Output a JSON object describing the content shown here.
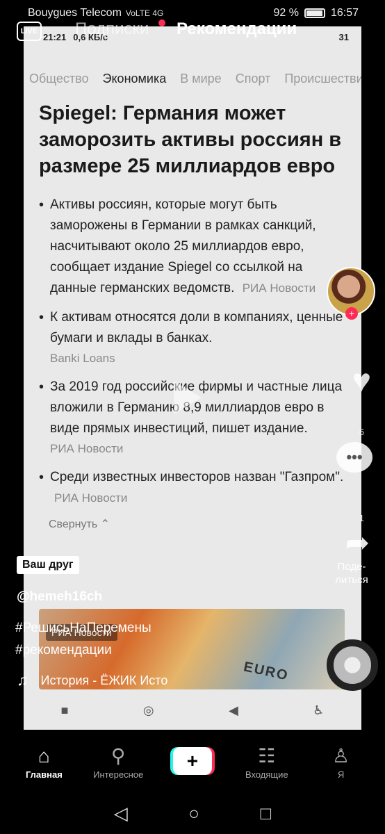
{
  "status_bar": {
    "carrier": "Bouygues Telecom",
    "network_icons": "VoLTE 4G",
    "battery": "92 %",
    "time": "16:57",
    "battery_level": 0.92
  },
  "inner_status": {
    "time": "21:21",
    "speed": "0,6 КБ/с",
    "battery": "31"
  },
  "inner_tabs": [
    "Общество",
    "Экономика",
    "В мире",
    "Спорт",
    "Происшествия"
  ],
  "inner_active_tab": "Экономика",
  "article": {
    "headline": "Spiegel: Германия может заморозить активы россиян в размере 25 миллиардов евро",
    "bullets": [
      {
        "text": "Активы россиян, которые могут быть заморожены в Германии в рамках санкций, насчитывают около 25 миллиардов евро, сообщает издание Spiegel со ссылкой на данные германских ведомств.",
        "source": "РИА Новости"
      },
      {
        "text": "К активам относятся доли в компаниях, ценные бумаги и вклады в банках.",
        "source": "Banki Loans"
      },
      {
        "text": "За 2019 год российские фирмы и частные лица вложили в Германию 8,9 миллиардов евро в виде прямых инвестиций, пишет издание.",
        "source": "РИА Новости"
      },
      {
        "text": "Среди известных инвесторов назван \"Газпром\".",
        "source": "РИА Новости"
      }
    ],
    "collapse": "Свернуть",
    "photo_label": "РИА Новости",
    "photo_text": "EURO"
  },
  "feed": {
    "live": "LIVE",
    "following": "Подписки",
    "for_you": "Рекомендации"
  },
  "side": {
    "like_count": "6",
    "comment_count": "1",
    "share_label": "Поде-литься"
  },
  "post": {
    "friend_badge": "Ваш друг",
    "username": "@hemeh16ch",
    "hashtags": [
      "#РешисьНаПеремены",
      "#рекомендации"
    ],
    "music": "История - ЁЖИК   Исто"
  },
  "bottom_nav": {
    "home": "Главная",
    "discover": "Интересное",
    "create": "+",
    "inbox": "Входящие",
    "me": "Я"
  },
  "icons": {
    "home": "home-icon",
    "discover": "search-icon",
    "inbox": "inbox-icon",
    "me": "profile-icon",
    "like": "heart-icon",
    "comment": "comment-icon",
    "share": "share-icon",
    "music": "music-note-icon"
  },
  "colors": {
    "accent_red": "#fe2c55",
    "accent_cyan": "#25f4ee",
    "background": "#000000"
  }
}
